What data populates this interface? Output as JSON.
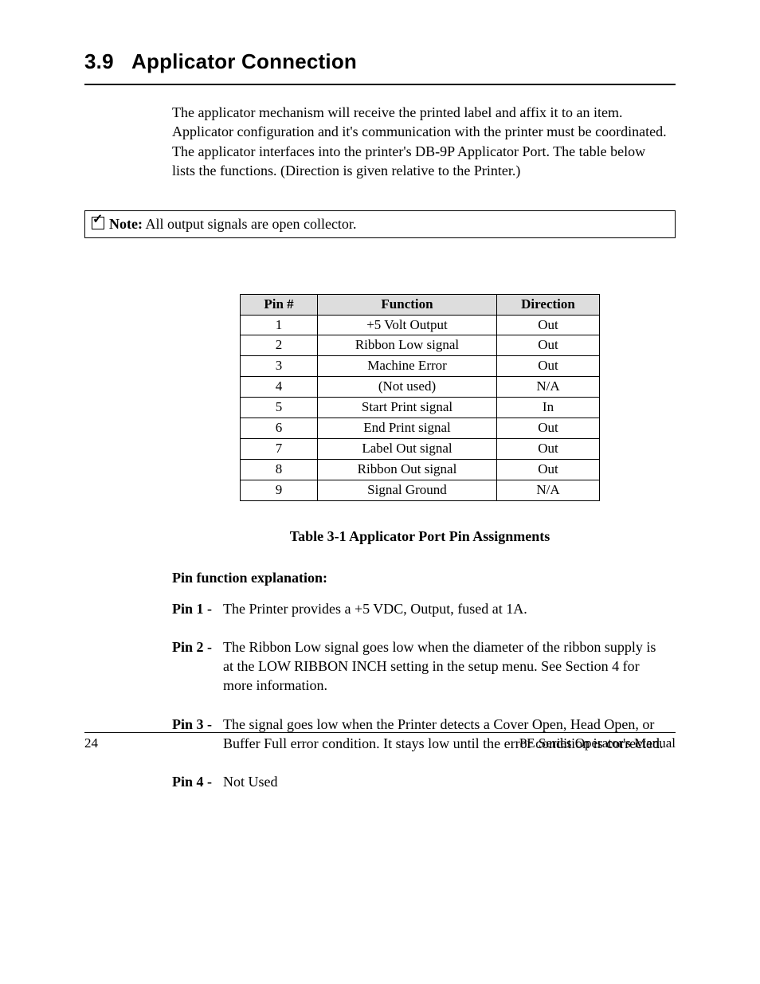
{
  "section": {
    "number": "3.9",
    "title": "Applicator Connection"
  },
  "intro": "The applicator mechanism will receive the printed label and  affix it to an item.  Applicator configuration and it's communication with the printer must be coordinated.  The applicator interfaces into the printer's DB-9P Applicator Port.  The table below lists the functions.  (Direction is given relative to the Printer.)",
  "note": {
    "label": "Note:",
    "text": "All output signals are open collector."
  },
  "table": {
    "headers": [
      "Pin #",
      "Function",
      "Direction"
    ],
    "rows": [
      {
        "pin": "1",
        "function": "+5 Volt Output",
        "direction": "Out"
      },
      {
        "pin": "2",
        "function": "Ribbon Low signal",
        "direction": "Out"
      },
      {
        "pin": "3",
        "function": "Machine Error",
        "direction": "Out"
      },
      {
        "pin": "4",
        "function": "(Not used)",
        "direction": "N/A"
      },
      {
        "pin": "5",
        "function": "Start Print signal",
        "direction": "In"
      },
      {
        "pin": "6",
        "function": "End Print signal",
        "direction": "Out"
      },
      {
        "pin": "7",
        "function": "Label Out signal",
        "direction": "Out"
      },
      {
        "pin": "8",
        "function": "Ribbon Out signal",
        "direction": "Out"
      },
      {
        "pin": "9",
        "function": "Signal Ground",
        "direction": "N/A"
      }
    ],
    "caption": "Table 3-1 Applicator Port Pin Assignments"
  },
  "explanation": {
    "heading": "Pin function explanation:",
    "items": [
      {
        "label": "Pin 1 -",
        "text": "The Printer provides a +5 VDC, Output, fused at 1A."
      },
      {
        "label": "Pin 2 -",
        "text": "The Ribbon Low signal goes low when the diameter of the ribbon supply is at the LOW RIBBON INCH setting in the setup menu.  See Section 4 for more information."
      },
      {
        "label": "Pin 3 -",
        "text": "The signal goes low when the Printer detects a Cover Open, Head Open, or Buffer Full error condition.  It stays low until the error condition is corrected."
      },
      {
        "label": "Pin 4 -",
        "text": "Not Used"
      }
    ]
  },
  "footer": {
    "page": "24",
    "manual": "PE Series Operator's Manual"
  }
}
